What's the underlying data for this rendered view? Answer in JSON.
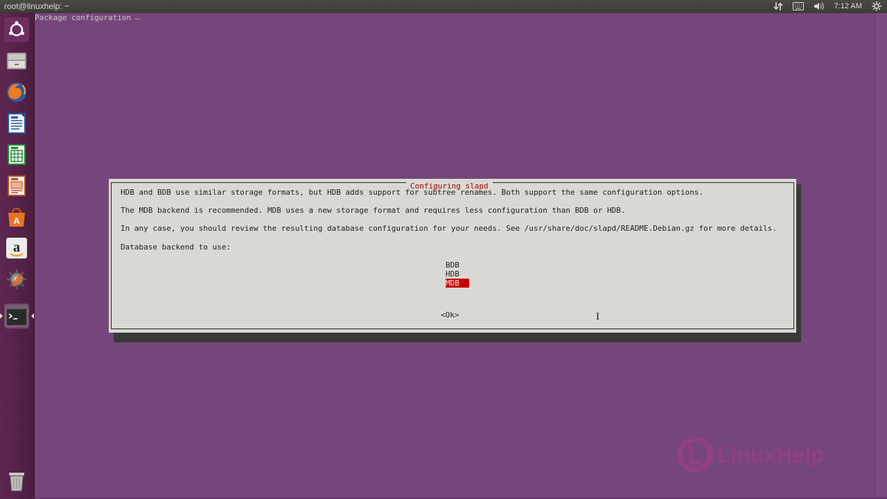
{
  "top_panel": {
    "window_title": "root@linuxhelp: ~",
    "time": "7:12 AM",
    "icons": [
      "network-icon",
      "keyboard-icon",
      "volume-icon",
      "settings-gear-icon"
    ]
  },
  "launcher": {
    "items": [
      {
        "name": "ubuntu-dash-icon"
      },
      {
        "name": "files-icon"
      },
      {
        "name": "firefox-icon"
      },
      {
        "name": "writer-icon"
      },
      {
        "name": "calc-icon"
      },
      {
        "name": "impress-icon"
      },
      {
        "name": "software-center-icon"
      },
      {
        "name": "amazon-icon"
      },
      {
        "name": "system-settings-icon"
      },
      {
        "name": "terminal-icon"
      },
      {
        "name": "trash-icon"
      }
    ]
  },
  "terminal": {
    "header": "Package configuration"
  },
  "dialog": {
    "title": "Configuring slapd",
    "line1": "HDB and BDB use similar storage formats, but HDB adds support for subtree renames. Both support the same configuration options.",
    "line2": "The MDB backend is recommended. MDB uses a new storage format and requires less configuration than BDB or HDB.",
    "line3": "In any case, you should review the resulting database configuration for your needs. See /usr/share/doc/slapd/README.Debian.gz for more details.",
    "prompt": "Database backend to use:",
    "options": [
      "BDB",
      "HDB",
      "MDB"
    ],
    "selected": "MDB",
    "ok_label": "<Ok>"
  },
  "watermark": {
    "text": "LinuxHelp"
  },
  "colors": {
    "terminal_bg": "#75467a",
    "dialog_bg": "#d9d9d4",
    "title_red": "#b00000",
    "selection_red": "#c40000",
    "launcher_bg": "#5e2750"
  }
}
